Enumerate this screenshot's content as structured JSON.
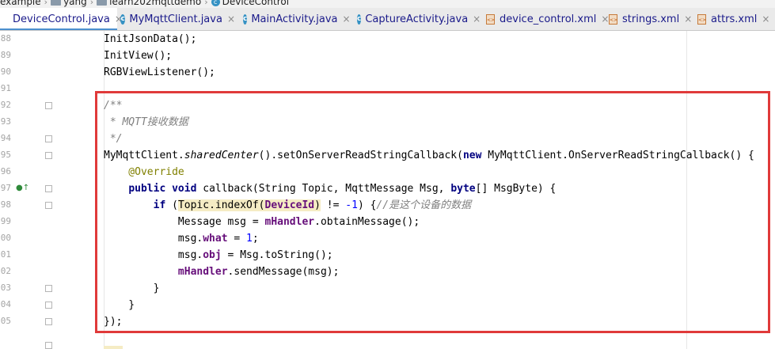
{
  "breadcrumb": {
    "items": [
      "example",
      "yang",
      "learn202mqttdemo",
      "DeviceControl"
    ]
  },
  "tabs": [
    {
      "label": "DeviceControl.java",
      "type": "class",
      "active": true
    },
    {
      "label": "MyMqttClient.java",
      "type": "class",
      "active": false
    },
    {
      "label": "MainActivity.java",
      "type": "class",
      "active": false
    },
    {
      "label": "CaptureActivity.java",
      "type": "class",
      "active": false
    },
    {
      "label": "device_control.xml",
      "type": "xml",
      "active": false
    },
    {
      "label": "strings.xml",
      "type": "xml",
      "active": false
    },
    {
      "label": "attrs.xml",
      "type": "xml",
      "active": false
    }
  ],
  "gutter": {
    "line_numbers": [
      "88",
      "89",
      "90",
      "91",
      "92",
      "93",
      "94",
      "95",
      "96",
      "97",
      "98",
      "99",
      "00",
      "01",
      "02",
      "03",
      "04",
      "05"
    ]
  },
  "code_lines": [
    "InitJsonData();",
    "InitView();",
    "RGBViewListener();",
    "",
    "/**",
    " * MQTT接收数据",
    " */",
    "MyMqttClient.sharedCenter().setOnServerReadStringCallback(new MyMqttClient.OnServerReadStringCallback() {",
    "    @Override",
    "    public void callback(String Topic, MqttMessage Msg, byte[] MsgByte) {",
    "        if (Topic.indexOf(DeviceId) != -1) {//是这个设备的数据",
    "            Message msg = mHandler.obtainMessage();",
    "            msg.what = 1;",
    "            msg.obj = Msg.toString();",
    "            mHandler.sendMessage(msg);",
    "        }",
    "    }",
    "});"
  ],
  "colors": {
    "highlight_box": "#e03a3a",
    "keyword": "#000080",
    "annotation": "#808000",
    "field": "#660e7a",
    "comment": "#808080",
    "number": "#0000ff"
  }
}
